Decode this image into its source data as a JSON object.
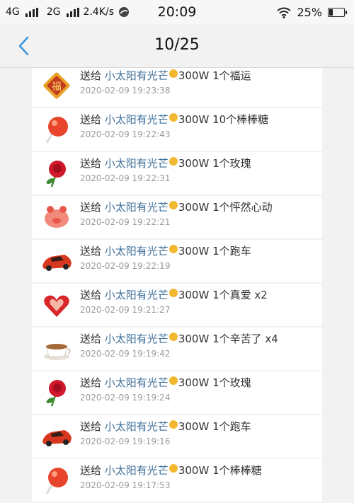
{
  "status_bar": {
    "net1": "4G",
    "net2": "2G",
    "speed": "2.4K/s",
    "time": "20:09",
    "battery": "25%"
  },
  "nav": {
    "title": "10/25"
  },
  "records": [
    {
      "action": "送给",
      "recipient": "小太阳有光芒",
      "amount": "300W",
      "gift": "1个福运",
      "time": "2020-02-09 19:23:38",
      "gift_icon": "fu-icon"
    },
    {
      "action": "送给",
      "recipient": "小太阳有光芒",
      "amount": "300W",
      "gift": "10个棒棒糖",
      "time": "2020-02-09 19:22:43",
      "gift_icon": "lollipop-icon"
    },
    {
      "action": "送给",
      "recipient": "小太阳有光芒",
      "amount": "300W",
      "gift": "1个玫瑰",
      "time": "2020-02-09 19:22:31",
      "gift_icon": "rose-icon"
    },
    {
      "action": "送给",
      "recipient": "小太阳有光芒",
      "amount": "300W",
      "gift": "1个怦然心动",
      "time": "2020-02-09 19:22:21",
      "gift_icon": "piggy-heart-icon"
    },
    {
      "action": "送给",
      "recipient": "小太阳有光芒",
      "amount": "300W",
      "gift": "1个跑车",
      "time": "2020-02-09 19:22:19",
      "gift_icon": "sports-car-icon"
    },
    {
      "action": "送给",
      "recipient": "小太阳有光芒",
      "amount": "300W",
      "gift": "1个真爱 x2",
      "time": "2020-02-09 19:21:27",
      "gift_icon": "true-love-icon"
    },
    {
      "action": "送给",
      "recipient": "小太阳有光芒",
      "amount": "300W",
      "gift": "1个辛苦了 x4",
      "time": "2020-02-09 19:19:42",
      "gift_icon": "coffee-icon"
    },
    {
      "action": "送给",
      "recipient": "小太阳有光芒",
      "amount": "300W",
      "gift": "1个玫瑰",
      "time": "2020-02-09 19:19:24",
      "gift_icon": "rose-icon"
    },
    {
      "action": "送给",
      "recipient": "小太阳有光芒",
      "amount": "300W",
      "gift": "1个跑车",
      "time": "2020-02-09 19:19:16",
      "gift_icon": "sports-car-icon"
    },
    {
      "action": "送给",
      "recipient": "小太阳有光芒",
      "amount": "300W",
      "gift": "1个棒棒糖",
      "time": "2020-02-09 19:17:53",
      "gift_icon": "lollipop-icon"
    }
  ]
}
